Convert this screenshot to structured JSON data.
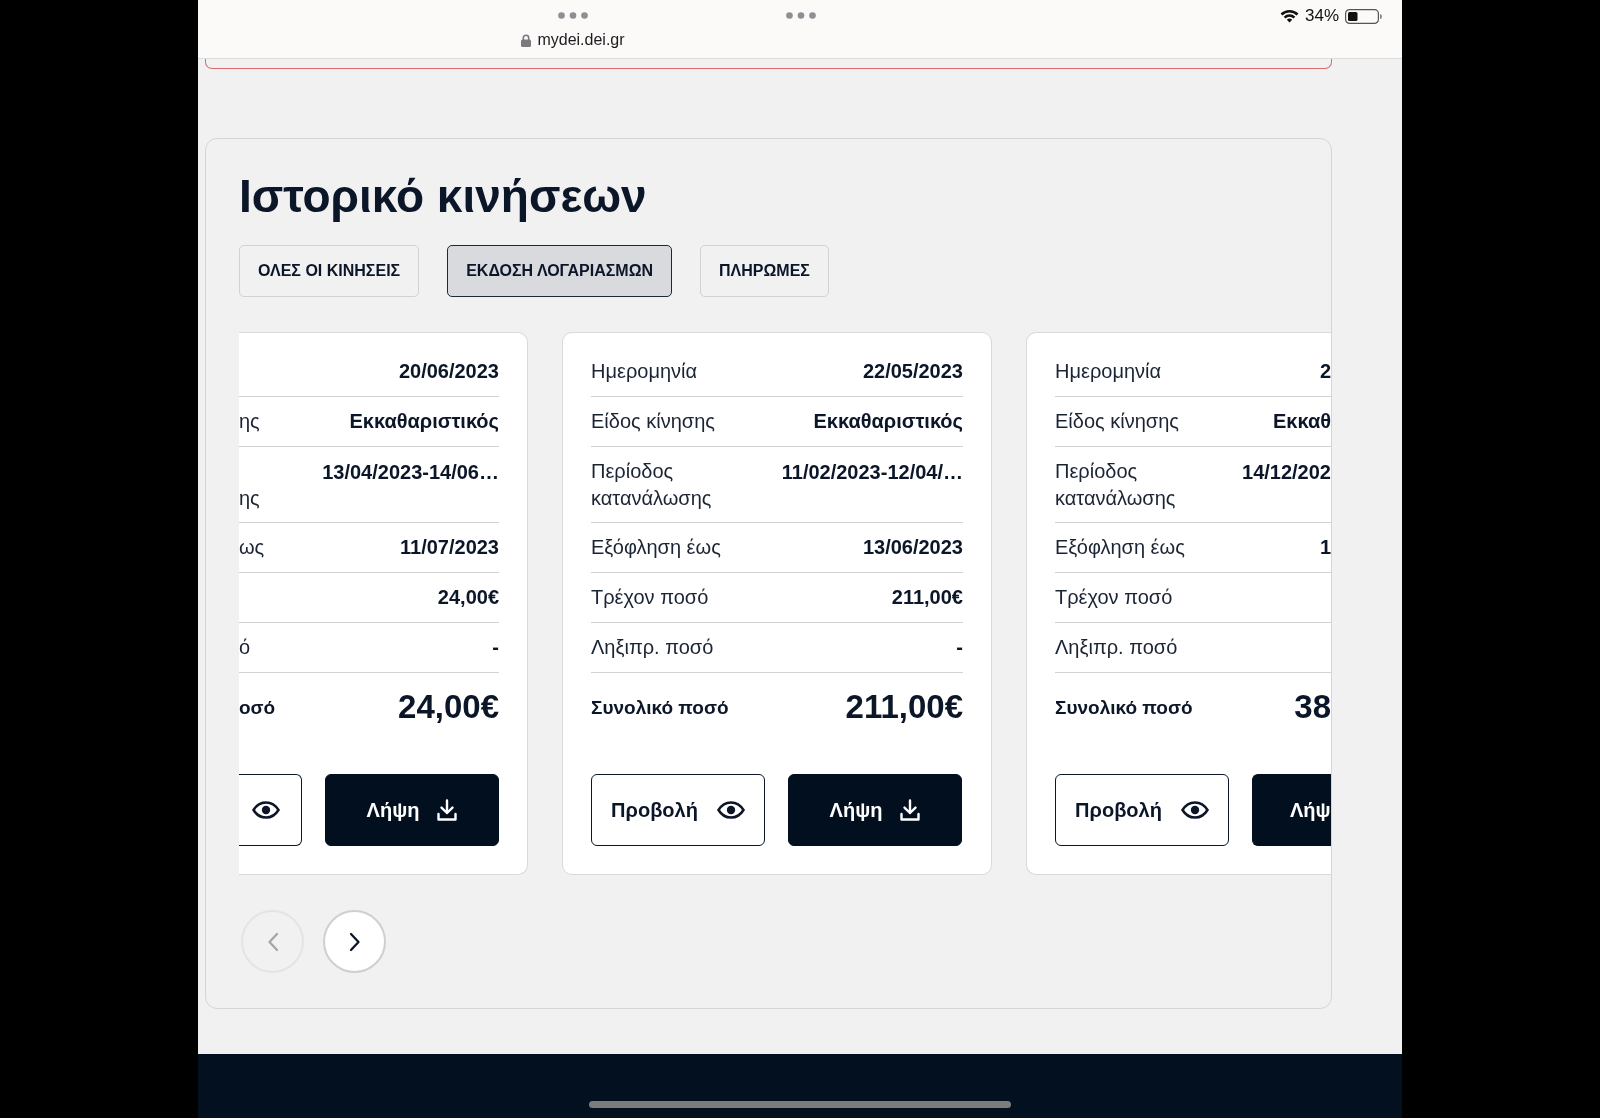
{
  "browser_bar": {
    "url": "mydei.dei.gr",
    "battery": "34%"
  },
  "history": {
    "title": "Ιστορικό κινήσεων",
    "tabs": [
      {
        "label": "ΟΛΕΣ ΟΙ ΚΙΝΗΣΕΙΣ",
        "selected": false
      },
      {
        "label": "ΕΚΔΟΣΗ ΛΟΓΑΡΙΑΣΜΩΝ",
        "selected": true
      },
      {
        "label": "ΠΛΗΡΩΜΕΣ",
        "selected": false
      }
    ],
    "cards": [
      {
        "kind": "clipped_left",
        "rows": [
          {
            "kind": "detail",
            "value": "20/06/2023"
          },
          {
            "kind": "detail",
            "label": "ης",
            "value": "Εκκαθαριστικός"
          },
          {
            "kind": "period",
            "label": "ης",
            "value": "13/04/2023-14/06…"
          },
          {
            "kind": "detail",
            "label": "ως",
            "value": "11/07/2023"
          },
          {
            "kind": "detail",
            "value": "24,00€"
          },
          {
            "kind": "detail",
            "label": "ό",
            "value": "-"
          },
          {
            "kind": "total",
            "label": "οσό",
            "value": "24,00€"
          }
        ],
        "buttons": [
          {
            "kind": "view"
          },
          {
            "kind": "download",
            "label": "Λήψη"
          }
        ]
      },
      {
        "kind": "whole",
        "rows": [
          {
            "kind": "detail",
            "label": "Ημερομηνία",
            "value": "22/05/2023"
          },
          {
            "kind": "detail",
            "label": "Είδος κίνησης",
            "value": "Εκκαθαριστικός"
          },
          {
            "kind": "period",
            "label": "Περίοδος κατανάλωσης",
            "value": "11/02/2023-12/04/…"
          },
          {
            "kind": "detail",
            "label": "Εξόφληση έως",
            "value": "13/06/2023"
          },
          {
            "kind": "detail",
            "label": "Τρέχον ποσό",
            "value": "211,00€"
          },
          {
            "kind": "detail",
            "label": "Ληξιπρ. ποσό",
            "value": "-"
          },
          {
            "kind": "total",
            "label": "Συνολικό ποσό",
            "value": "211,00€"
          }
        ],
        "buttons": [
          {
            "kind": "view",
            "label": "Προβολή"
          },
          {
            "kind": "download",
            "label": "Λήψη"
          }
        ]
      },
      {
        "kind": "clipped_right",
        "rows": [
          {
            "kind": "detail",
            "label": "Ημερομηνία",
            "value": "2"
          },
          {
            "kind": "detail",
            "label": "Είδος κίνησης",
            "value": "Εκκαθ"
          },
          {
            "kind": "period",
            "label": "Περίοδος κατανάλωσης",
            "value": "14/12/202"
          },
          {
            "kind": "detail",
            "label": "Εξόφληση έως",
            "value": "1"
          },
          {
            "kind": "detail",
            "label": "Τρέχον ποσό"
          },
          {
            "kind": "detail",
            "label": "Ληξιπρ. ποσό"
          },
          {
            "kind": "total",
            "label": "Συνολικό ποσό",
            "value": "38"
          }
        ],
        "buttons": [
          {
            "kind": "view",
            "label": "Προβολή"
          },
          {
            "kind": "download",
            "label": "Λήψ"
          }
        ]
      }
    ],
    "pagination": [
      {
        "kind": "previous",
        "disabled": true
      },
      {
        "kind": "next",
        "disabled": false
      }
    ]
  }
}
